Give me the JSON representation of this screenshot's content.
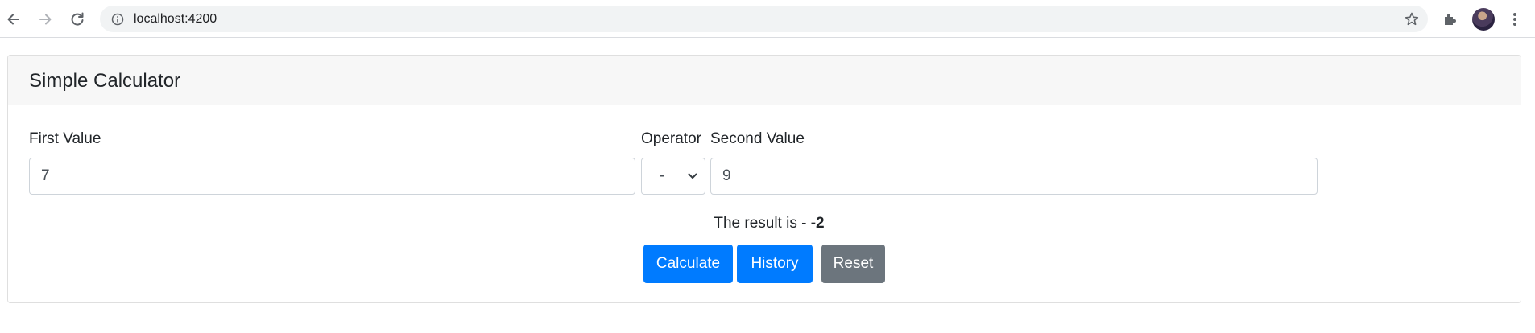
{
  "browser": {
    "url": "localhost:4200"
  },
  "card": {
    "title": "Simple Calculator"
  },
  "form": {
    "first_label": "First Value",
    "first_value": "7",
    "operator_label": "Operator",
    "operator_value": "-",
    "second_label": "Second Value",
    "second_value": "9"
  },
  "result": {
    "prefix": "The result is - ",
    "value": "-2"
  },
  "buttons": {
    "calculate": "Calculate",
    "history": "History",
    "reset": "Reset"
  },
  "colors": {
    "primary": "#007bff",
    "secondary": "#6c757d",
    "header_bg": "#f7f7f7"
  },
  "icons": [
    "back-arrow-icon",
    "forward-arrow-icon",
    "reload-icon",
    "info-icon",
    "star-icon",
    "extensions-icon",
    "avatar",
    "more-vert-icon",
    "chevron-down-icon"
  ]
}
